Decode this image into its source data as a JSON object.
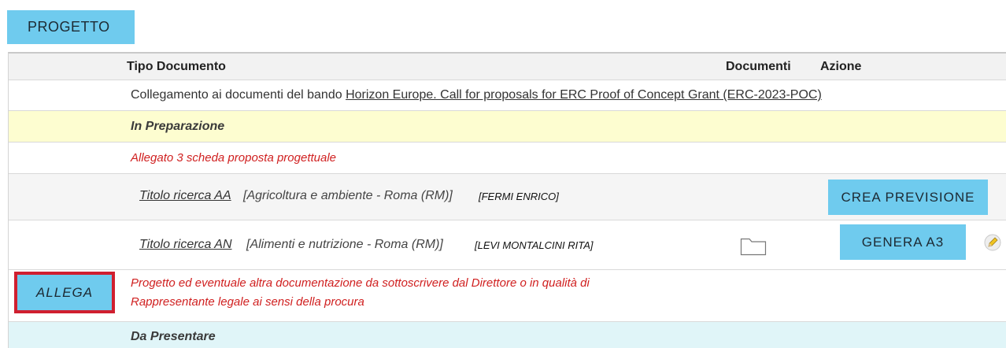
{
  "tab": {
    "label": "PROGETTO"
  },
  "table": {
    "headers": {
      "tipo": "Tipo Documento",
      "documenti": "Documenti",
      "azione": "Azione"
    },
    "link_row": {
      "prefix": "Collegamento ai documenti del bando ",
      "link": "Horizon Europe. Call for proposals for ERC Proof of Concept Grant (ERC-2023-POC)"
    },
    "section_prep": "In Preparazione",
    "allegato3": "Allegato 3 scheda proposta progettuale",
    "items": [
      {
        "title": "Titolo ricerca AA",
        "area": "[Agricoltura e ambiente - Roma (RM)]",
        "person": "[FERMI ENRICO]",
        "action": "CREA PREVISIONE"
      },
      {
        "title": "Titolo ricerca AN",
        "area": "[Alimenti e nutrizione - Roma (RM)]",
        "person": "[LEVI MONTALCINI RITA]",
        "action": "GENERA A3"
      }
    ],
    "allega": {
      "button": "ALLEGA",
      "line1": "Progetto ed eventuale altra documentazione da sottoscrivere dal Direttore o in qualità di",
      "line2": "Rappresentante legale ai sensi della procura"
    },
    "section_present": "Da Presentare"
  },
  "colors": {
    "accent": "#6fcbee",
    "highlight_yellow": "#fdfdd0",
    "highlight_cyan": "#e0f5f8",
    "row_gray": "#f5f5f5",
    "error_red": "#d02020",
    "focus_border": "#d01f2f"
  }
}
